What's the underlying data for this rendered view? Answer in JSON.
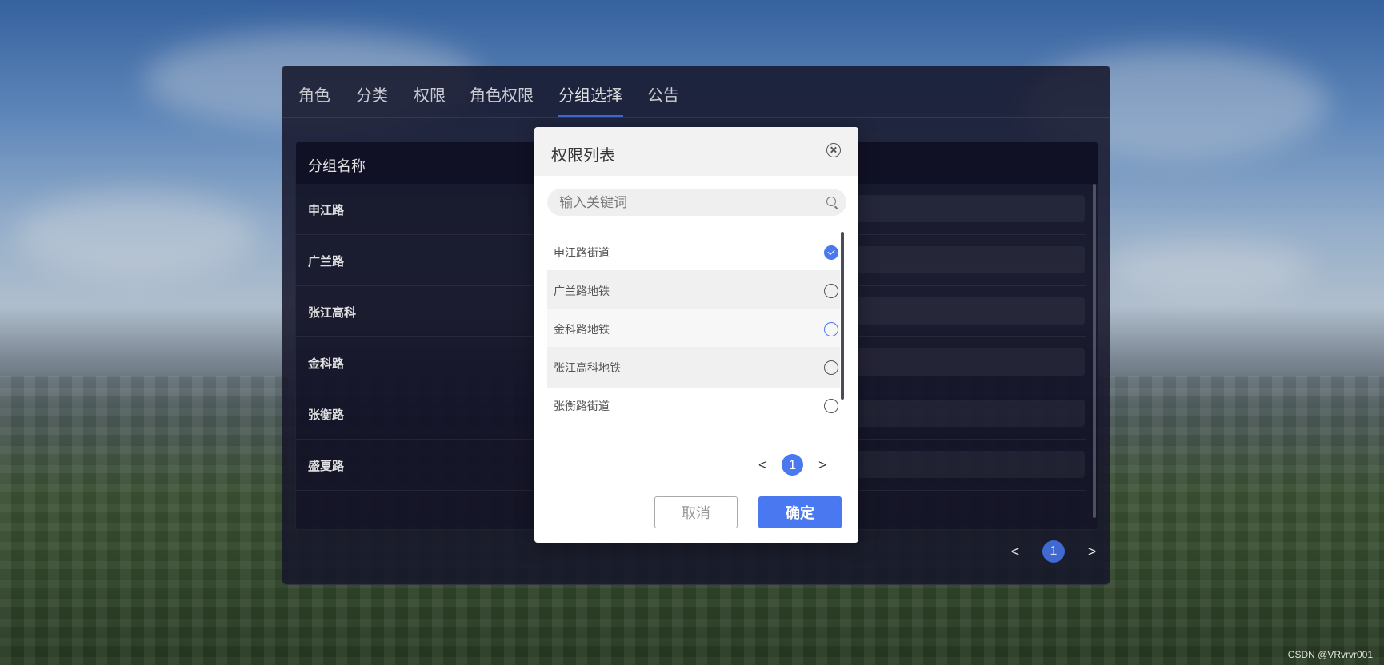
{
  "tabs": [
    {
      "label": "角色"
    },
    {
      "label": "分类"
    },
    {
      "label": "权限"
    },
    {
      "label": "角色权限"
    },
    {
      "label": "分组选择",
      "active": true
    },
    {
      "label": "公告"
    }
  ],
  "group_table": {
    "header": "分组名称",
    "rows": [
      {
        "name": "申江路"
      },
      {
        "name": "广兰路"
      },
      {
        "name": "张江高科"
      },
      {
        "name": "金科路"
      },
      {
        "name": "张衡路"
      },
      {
        "name": "盛夏路"
      }
    ]
  },
  "main_pager": {
    "prev": "<",
    "page": "1",
    "next": ">"
  },
  "modal": {
    "title": "权限列表",
    "search_placeholder": "输入关键词",
    "options": [
      {
        "label": "申江路街道",
        "checked": true
      },
      {
        "label": "广兰路地铁",
        "checked": false
      },
      {
        "label": "金科路地铁",
        "checked": false
      },
      {
        "label": "张江高科地铁",
        "checked": false
      },
      {
        "label": "张衡路街道",
        "checked": false
      }
    ],
    "pager": {
      "prev": "<",
      "page": "1",
      "next": ">"
    },
    "cancel_label": "取消",
    "ok_label": "确定"
  },
  "watermark": "CSDN @VRvrvr001",
  "colors": {
    "accent": "#4a78f0",
    "panel_bg": "#18182f",
    "header_bg": "#14142c"
  }
}
